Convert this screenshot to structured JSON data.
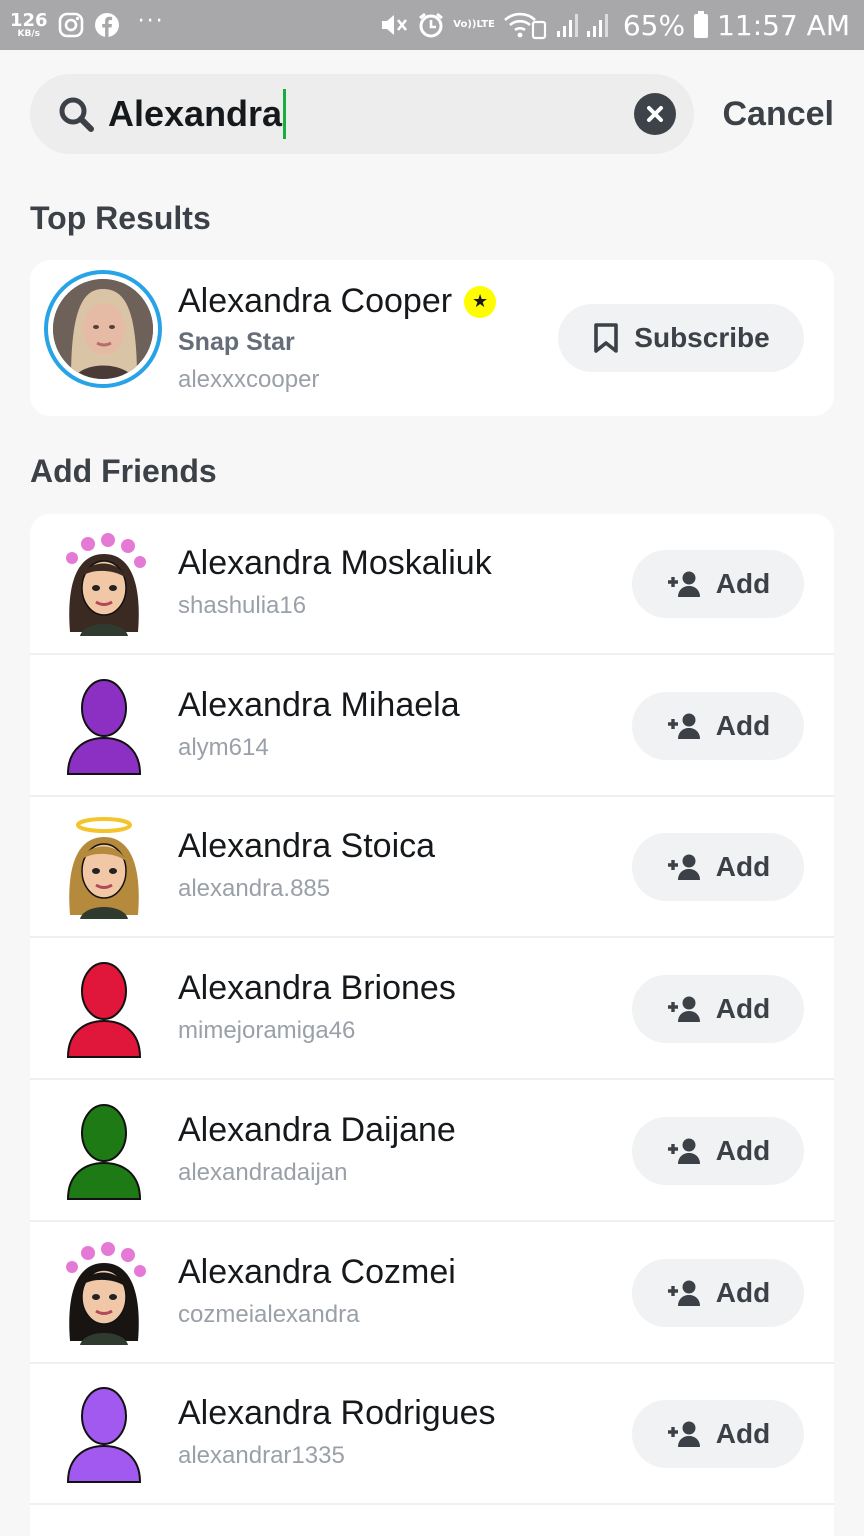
{
  "status_bar": {
    "net_speed": "126",
    "net_unit": "KB/s",
    "icons": [
      "instagram-icon",
      "facebook-icon",
      "more-dots-icon",
      "mute-icon",
      "alarm-icon",
      "volte-icon",
      "wifi-icon",
      "signal-icon",
      "battery-icon"
    ],
    "dots": "···",
    "volte_top": "Vo))",
    "volte_bottom": "LTE",
    "battery": "65%",
    "time": "11:57 AM"
  },
  "search": {
    "query": "Alexandra",
    "cancel_label": "Cancel",
    "caret_color": "#14b03d"
  },
  "top_results": {
    "heading": "Top Results",
    "item": {
      "name": "Alexandra Cooper",
      "badge": "★",
      "subtitle": "Snap Star",
      "username": "alexxxcooper",
      "button_label": "Subscribe",
      "ring_color": "#28a4e6"
    }
  },
  "add_friends": {
    "heading": "Add Friends",
    "button_label": "Add",
    "items": [
      {
        "name": "Alexandra Moskaliuk",
        "username": "shashulia16",
        "avatar": "bitmoji-hearts-brunette"
      },
      {
        "name": "Alexandra Mihaela",
        "username": "alym614",
        "avatar": "silhouette",
        "color": "#8b30c3"
      },
      {
        "name": "Alexandra Stoica",
        "username": "alexandra.885",
        "avatar": "bitmoji-halo-blonde"
      },
      {
        "name": "Alexandra Briones",
        "username": "mimejoramiga46",
        "avatar": "silhouette",
        "color": "#e0163a"
      },
      {
        "name": "Alexandra Daijane",
        "username": "alexandradaijan",
        "avatar": "silhouette",
        "color": "#1d7a14"
      },
      {
        "name": "Alexandra Cozmei",
        "username": "cozmeialexandra",
        "avatar": "bitmoji-hearts-dark"
      },
      {
        "name": "Alexandra Rodrigues",
        "username": "alexandrar1335",
        "avatar": "silhouette",
        "color": "#a259f0"
      }
    ]
  }
}
